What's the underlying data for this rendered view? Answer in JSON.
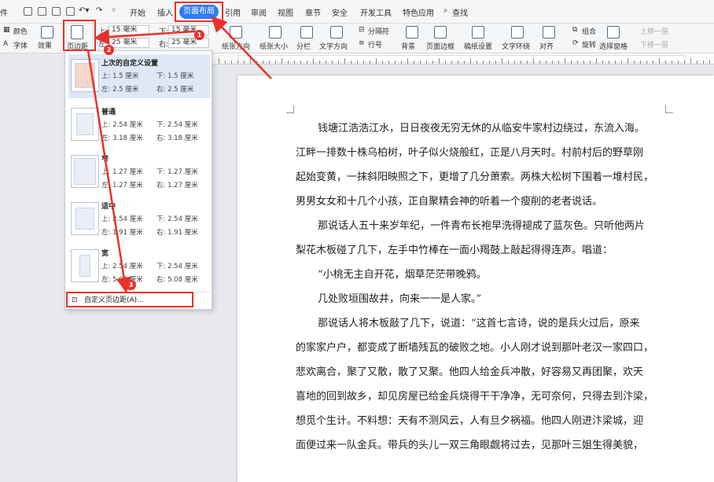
{
  "menubar": {
    "file": "件",
    "items": [
      "开始",
      "插入",
      "引用",
      "审阅",
      "视图",
      "章节",
      "安全",
      "开发工具",
      "特色应用",
      "查找"
    ],
    "active_tab": "页面布局"
  },
  "ribbon": {
    "color_label": "颜色",
    "font_label": "字体",
    "effect_label": "效果",
    "margin_button": "页边距",
    "top_label": "上:",
    "top_value": "15 毫米",
    "bottom_label": "下:",
    "bottom_value": "15 毫米",
    "left_label": "左:",
    "left_value": "25 毫米",
    "right_label": "右:",
    "right_value": "25 毫米",
    "orientation": "纸张方向",
    "size": "纸张大小",
    "columns": "分栏",
    "text_direction": "文字方向",
    "separator": "分隔符",
    "line_number": "行号",
    "background": "背景",
    "page_border": "页面边框",
    "grid_settings": "稿纸设置",
    "wrap": "文字环绕",
    "align": "对齐",
    "group": "组合",
    "rotate": "旋转",
    "select_pane": "选择窗格",
    "bring_forward": "上移一层",
    "send_backward": "下移一层"
  },
  "dropdown": {
    "presets": [
      {
        "name": "上次的自定义设置",
        "top": "上: 1.5 厘米",
        "bottom": "下: 1.5 厘米",
        "left": "左: 2.5 厘米",
        "right": "右: 2.5 厘米"
      },
      {
        "name": "普通",
        "top": "上: 2.54 厘米",
        "bottom": "下: 2.54 厘米",
        "left": "左: 3.18 厘米",
        "right": "右: 3.18 厘米"
      },
      {
        "name": "窄",
        "top": "上: 1.27 厘米",
        "bottom": "下: 1.27 厘米",
        "left": "左: 1.27 厘米",
        "right": "右: 1.27 厘米"
      },
      {
        "name": "适中",
        "top": "上: 2.54 厘米",
        "bottom": "下: 2.54 厘米",
        "left": "左: 1.91 厘米",
        "right": "右: 1.91 厘米"
      },
      {
        "name": "宽",
        "top": "上: 2.54 厘米",
        "bottom": "下: 2.54 厘米",
        "left": "左: 5.08 厘米",
        "right": "右: 5.08 厘米"
      }
    ],
    "custom": "自定义页边距(A)..."
  },
  "annotations": {
    "n1": "1",
    "n2": "2",
    "n3": "3",
    "color": "#e8312a"
  },
  "document": {
    "lines": [
      "钱塘江浩浩江水，日日夜夜无穷无休的从临安牛家村边绕过，东流入海。",
      "江畔一排数十株乌柏树，叶子似火烧般红，正是八月天时。村前村后的野草刚",
      "起始变黄，一抹斜阳映照之下，更增了几分萧索。两株大松树下围着一堆村民，",
      "男男女女和十几个小孩，正自聚精会神的听着一个瘦削的老者说话。",
      "那说话人五十来岁年纪，一件青布长袍早洗得褪成了蓝灰色。只听他两片",
      "梨花木板碰了几下，左手中竹棒在一面小羯鼓上敲起得得连声。唱道：",
      "“小桃无主自开花，烟草茫茫带晚鸦。",
      "几处败垣围故井，向来一一是人家。”",
      "那说话人将木板敲了几下，说道：“这首七言诗，说的是兵火过后，原来",
      "的家家户户，都变成了断墙残瓦的破败之地。小人刚才说到那叶老汉一家四口，",
      "悲欢离合，聚了又散，散了又聚。他四人给金兵冲散，好容易又再团聚，欢天",
      "喜地的回到故乡，却见房屋已给金兵烧得干干净净，无可奈何，只得去到汴梁，",
      "想觅个生计。不料想：天有不测风云，人有旦夕祸福。他四人刚进汴梁城，迎",
      "面便过来一队金兵。带兵的头儿一双三角眼觑将过去，见那叶三姐生得美貌，"
    ]
  }
}
